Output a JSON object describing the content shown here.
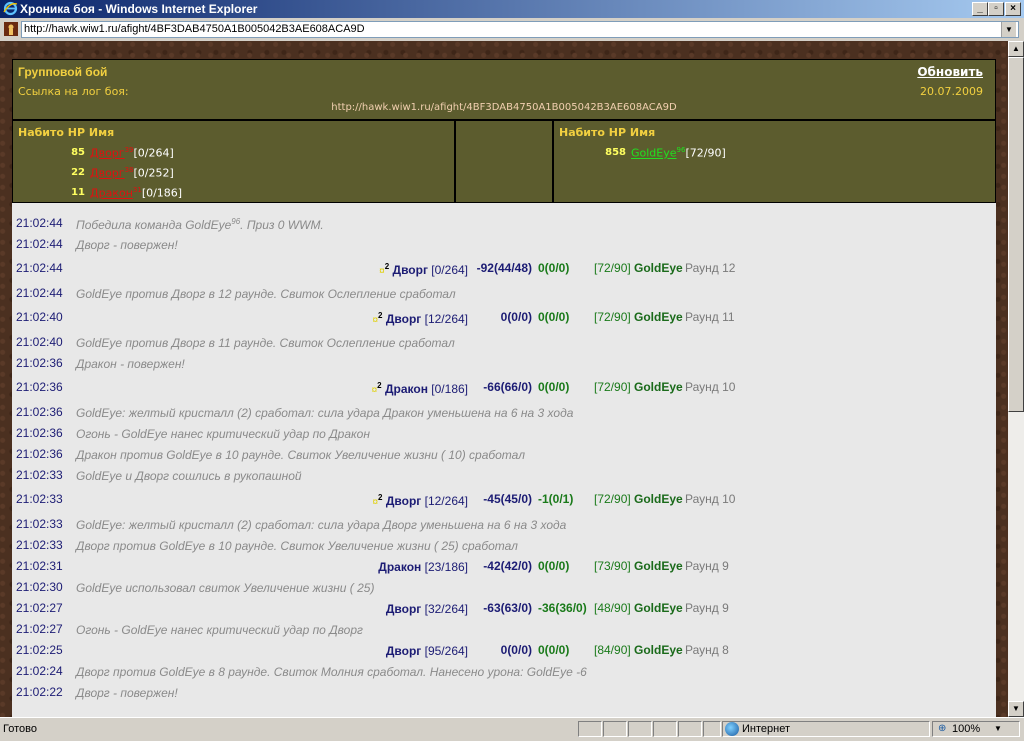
{
  "window": {
    "title": "Хроника боя - Windows Internet Explorer",
    "url": "http://hawk.wiw1.ru/afight/4BF3DAB4750A1B005042B3AE608ACA9D"
  },
  "header": {
    "title": "Групповой бой",
    "refresh": "Обновить",
    "log_label": "Ссылка на лог боя:",
    "date": "20.07.2009",
    "log_url": "http://hawk.wiw1.ru/afight/4BF3DAB4750A1B005042B3AE608ACA9D"
  },
  "team_left": {
    "col_hp": "Набито НР",
    "col_name": "Имя",
    "members": [
      {
        "dmg": "85",
        "name": "Дворг",
        "level": "39",
        "hp": "[0/264]"
      },
      {
        "dmg": "22",
        "name": "Дворг",
        "level": "38",
        "hp": "[0/252]"
      },
      {
        "dmg": "11",
        "name": "Дракон",
        "level": "31",
        "hp": "[0/186]"
      }
    ]
  },
  "team_right": {
    "col_hp": "Набито НР",
    "col_name": "Имя",
    "members": [
      {
        "dmg": "858",
        "name": "GoldEye",
        "level": "96",
        "hp": "[72/90]"
      }
    ]
  },
  "log": [
    {
      "time": "21:02:44",
      "msg": "Победила команда GoldEye",
      "sup": "96",
      "msg2": ". Приз 0 WWM."
    },
    {
      "time": "21:02:44",
      "msg": "Дворг - повержен!"
    },
    {
      "time": "21:02:44",
      "star": "¤",
      "sup2": "2",
      "attacker": "Дворг",
      "ahp": "[0/264]",
      "d1": "-92(44/48)",
      "d2": "0(0/0)",
      "dhp": "[72/90]",
      "dname": "GoldEye",
      "round": "Раунд 12"
    },
    {
      "time": "21:02:44",
      "msg": "GoldEye против Дворг в 12 раунде. Свиток Ослепление сработал"
    },
    {
      "time": "21:02:40",
      "star": "¤",
      "sup2": "2",
      "attacker": "Дворг",
      "ahp": "[12/264]",
      "d1": "0(0/0)",
      "d2": "0(0/0)",
      "dhp": "[72/90]",
      "dname": "GoldEye",
      "round": "Раунд 11"
    },
    {
      "time": "21:02:40",
      "msg": "GoldEye против Дворг в 11 раунде. Свиток Ослепление сработал"
    },
    {
      "time": "21:02:36",
      "msg": "Дракон - повержен!"
    },
    {
      "time": "21:02:36",
      "star": "¤",
      "sup2": "2",
      "attacker": "Дракон",
      "ahp": "[0/186]",
      "d1": "-66(66/0)",
      "d2": "0(0/0)",
      "dhp": "[72/90]",
      "dname": "GoldEye",
      "round": "Раунд 10"
    },
    {
      "time": "21:02:36",
      "msg": "GoldEye: желтый кристалл (2) сработал: сила удара Дракон уменьшена на 6 на 3 хода"
    },
    {
      "time": "21:02:36",
      "msg": "Огонь - GoldEye нанес критический удар по Дракон"
    },
    {
      "time": "21:02:36",
      "msg": "Дракон против GoldEye в 10 раунде. Свиток Увеличение жизни ( 10) сработал"
    },
    {
      "time": "21:02:33",
      "msg": "GoldEye и Дворг сошлись в рукопашной"
    },
    {
      "time": "21:02:33",
      "star": "¤",
      "sup2": "2",
      "attacker": "Дворг",
      "ahp": "[12/264]",
      "d1": "-45(45/0)",
      "d2": "-1(0/1)",
      "dhp": "[72/90]",
      "dname": "GoldEye",
      "round": "Раунд 10"
    },
    {
      "time": "21:02:33",
      "msg": "GoldEye: желтый кристалл (2) сработал: сила удара Дворг уменьшена на 6 на 3 хода"
    },
    {
      "time": "21:02:33",
      "msg": "Дворг против GoldEye в 10 раунде. Свиток Увеличение жизни ( 25) сработал"
    },
    {
      "time": "21:02:31",
      "attacker": "Дракон",
      "ahp": "[23/186]",
      "d1": "-42(42/0)",
      "d2": "0(0/0)",
      "dhp": "[73/90]",
      "dname": "GoldEye",
      "round": "Раунд 9"
    },
    {
      "time": "21:02:30",
      "msg": "GoldEye использовал свиток Увеличение жизни ( 25)"
    },
    {
      "time": "21:02:27",
      "attacker": "Дворг",
      "ahp": "[32/264]",
      "d1": "-63(63/0)",
      "d2": "-36(36/0)",
      "dhp": "[48/90]",
      "dname": "GoldEye",
      "round": "Раунд 9"
    },
    {
      "time": "21:02:27",
      "msg": "Огонь - GoldEye нанес критический удар по Дворг"
    },
    {
      "time": "21:02:25",
      "attacker": "Дворг",
      "ahp": "[95/264]",
      "d1": "0(0/0)",
      "d2": "0(0/0)",
      "dhp": "[84/90]",
      "dname": "GoldEye",
      "round": "Раунд 8"
    },
    {
      "time": "21:02:24",
      "msg": "Дворг против GoldEye в 8 раунде. Свиток Молния сработал. Нанесено урона: GoldEye -6"
    },
    {
      "time": "21:02:22",
      "msg": "Дворг - повержен!"
    }
  ],
  "status": {
    "text": "Готово",
    "zone": "Интернет",
    "zoom": "100%"
  },
  "colors": {
    "panel": "#5c5c2e",
    "header_text": "#f2d040",
    "log_bg": "#e8e8e8",
    "enemy_link": "#e01010",
    "ally_link": "#20e020"
  }
}
